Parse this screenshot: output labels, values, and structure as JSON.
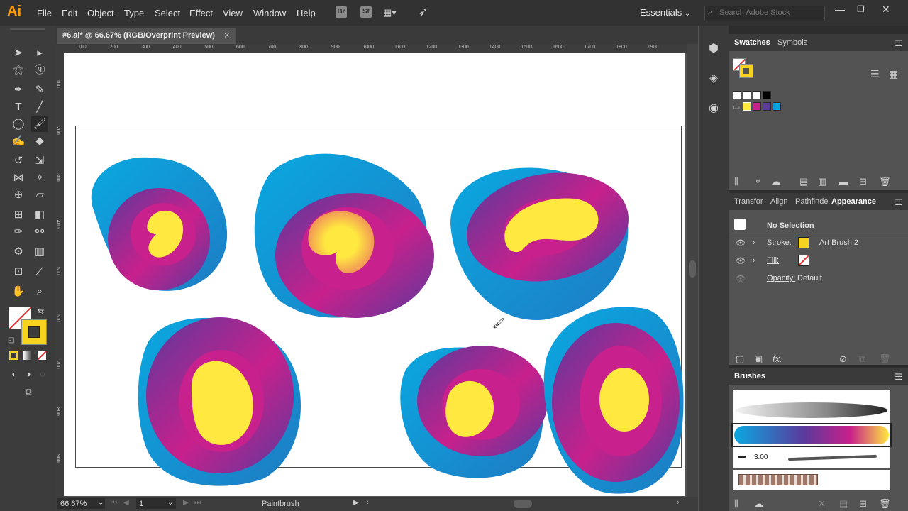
{
  "app": {
    "logo": "Ai"
  },
  "menu": {
    "items": [
      "File",
      "Edit",
      "Object",
      "Type",
      "Select",
      "Effect",
      "View",
      "Window",
      "Help"
    ],
    "bridge_badge": "Br",
    "stock_badge": "St",
    "workspace": "Essentials",
    "search_placeholder": "Search Adobe Stock"
  },
  "document": {
    "tab_title": "#6.ai* @ 66.67% (RGB/Overprint Preview)",
    "close_glyph": "×"
  },
  "ruler": {
    "h_ticks": [
      "100",
      "200",
      "300",
      "400",
      "500",
      "600",
      "700",
      "800",
      "900",
      "1000",
      "1100",
      "1200",
      "1300",
      "1400",
      "1500",
      "1600",
      "1700",
      "1800",
      "1900"
    ],
    "v_ticks": [
      "100",
      "200",
      "300",
      "400",
      "500",
      "600",
      "700",
      "800",
      "900"
    ]
  },
  "statusbar": {
    "zoom": "66.67%",
    "page": "1",
    "tool": "Paintbrush"
  },
  "panels": {
    "swatches": {
      "tabs": [
        "Swatches",
        "Symbols"
      ],
      "active": "Swatches"
    },
    "appearance": {
      "tabs": [
        "Transfor",
        "Align",
        "Pathfinde",
        "Appearance"
      ],
      "active": "Appearance",
      "selection": "No Selection",
      "stroke_label": "Stroke:",
      "stroke_value": "Art Brush 2",
      "stroke_color": "#f5d320",
      "fill_label": "Fill:",
      "opacity_label": "Opacity:",
      "opacity_value": "Default"
    },
    "brushes": {
      "title": "Brushes",
      "size_value": "3.00"
    }
  },
  "colors": {
    "blue": "#0aa0dc",
    "purple": "#5a3a9c",
    "magenta": "#c8208c",
    "yellow": "#ffe840"
  }
}
